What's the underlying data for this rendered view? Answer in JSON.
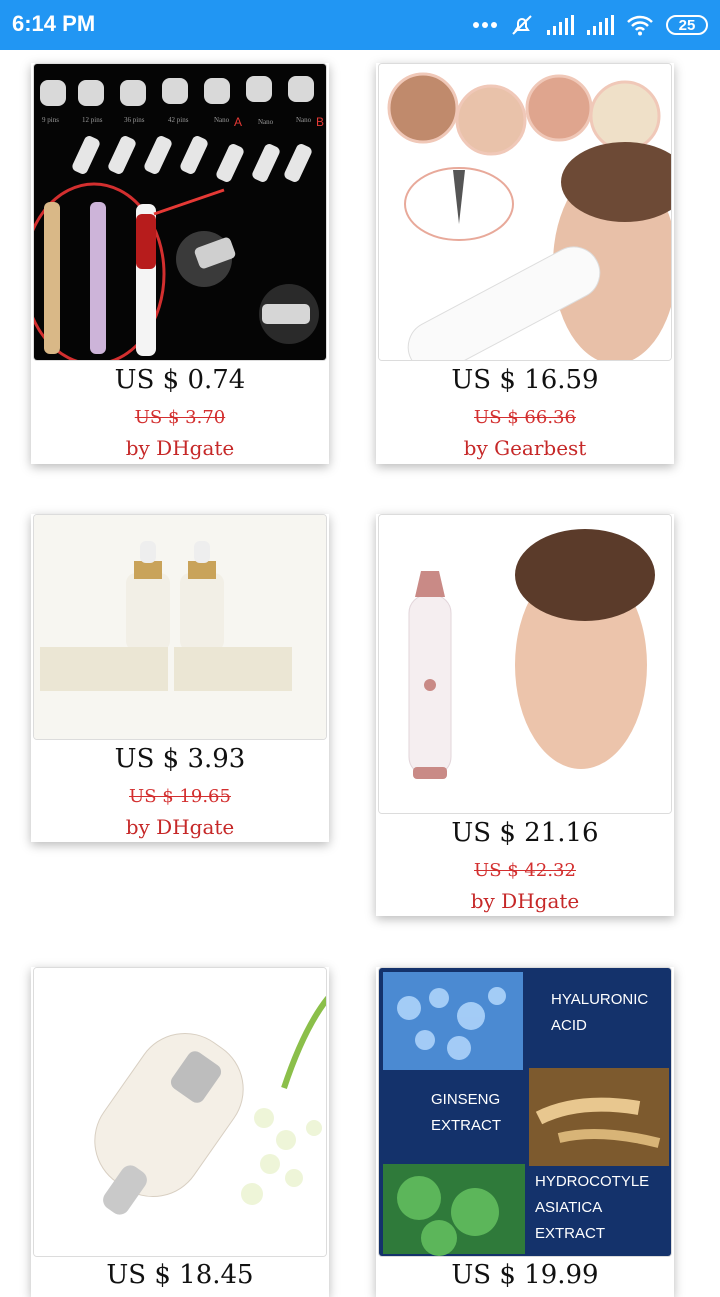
{
  "status_bar": {
    "time": "6:14 PM",
    "battery": "25",
    "icons": [
      "more-dots-icon",
      "mute-icon",
      "signal-icon",
      "signal-icon",
      "wifi-icon",
      "battery-icon"
    ]
  },
  "products": [
    {
      "price": "US $ 0.74",
      "original_price": "US $ 3.70",
      "store": "by DHgate",
      "image_labels": [
        "9 pins",
        "12 pins",
        "36 pins",
        "42 pins",
        "Nano",
        "Nano",
        "A",
        "B"
      ]
    },
    {
      "price": "US $ 16.59",
      "original_price": "US $ 66.36",
      "store": "by Gearbest"
    },
    {
      "price": "US $ 3.93",
      "original_price": "US $ 19.65",
      "store": "by DHgate"
    },
    {
      "price": "US $ 21.16",
      "original_price": "US $ 42.32",
      "store": "by DHgate"
    },
    {
      "price": "US $ 18.45",
      "original_price": "",
      "store": ""
    },
    {
      "price": "US $ 19.99",
      "original_price": "",
      "store": "",
      "image_labels": [
        "HYALURONIC",
        "ACID",
        "GINSENG",
        "EXTRACT",
        "HYDROCOTYLE",
        "ASIATICA",
        "EXTRACT"
      ]
    }
  ]
}
